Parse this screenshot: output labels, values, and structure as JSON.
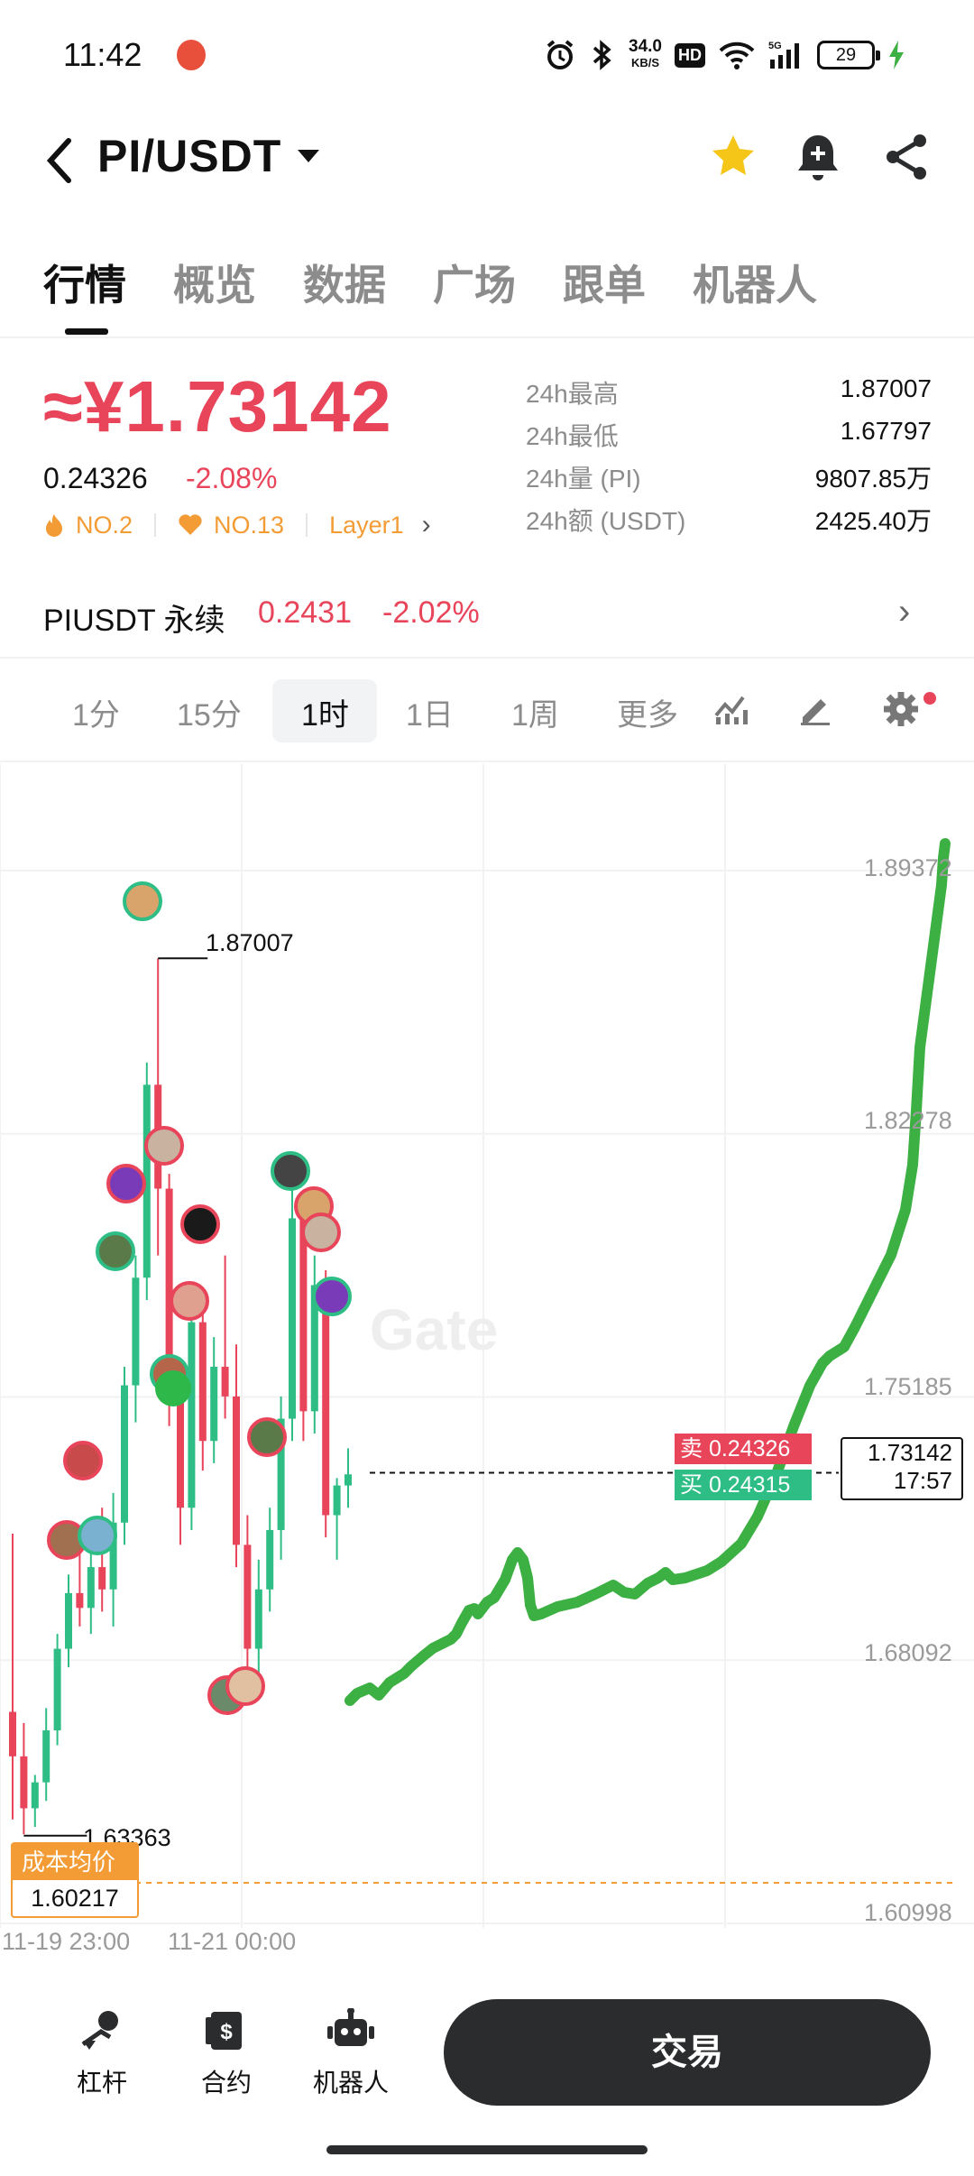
{
  "status_bar": {
    "time": "11:42",
    "net_speed_value": "34.0",
    "net_speed_unit": "KB/S",
    "hd": "HD",
    "network": "5G",
    "battery": "29"
  },
  "header": {
    "title": "PI/USDT",
    "icons": [
      "back-icon",
      "caret-down-icon",
      "star-icon",
      "bell-plus-icon",
      "share-icon"
    ],
    "star_color": "#f5c518"
  },
  "tabs": [
    {
      "label": "行情",
      "active": true
    },
    {
      "label": "概览"
    },
    {
      "label": "数据"
    },
    {
      "label": "广场"
    },
    {
      "label": "跟单"
    },
    {
      "label": "机器人"
    }
  ],
  "price": {
    "main": "≈¥1.73142",
    "usdt": "0.24326",
    "change": "-2.08%",
    "rank1": "NO.2",
    "rank2": "NO.13",
    "sector": "Layer1",
    "down_color": "#e8445a",
    "up_color": "#2ebd85"
  },
  "stats": [
    {
      "label": "24h最高",
      "value": "1.87007"
    },
    {
      "label": "24h最低",
      "value": "1.67797"
    },
    {
      "label": "24h量 (PI)",
      "value": "9807.85万"
    },
    {
      "label": "24h额 (USDT)",
      "value": "2425.40万"
    }
  ],
  "perpetual": {
    "name": "PIUSDT 永续",
    "price": "0.2431",
    "change": "-2.02%"
  },
  "intervals": [
    {
      "label": "1分"
    },
    {
      "label": "15分"
    },
    {
      "label": "1时",
      "active": true
    },
    {
      "label": "1日"
    },
    {
      "label": "1周"
    },
    {
      "label": "更多"
    }
  ],
  "chart": {
    "y_axis": [
      "1.89372",
      "1.82278",
      "1.75185",
      "1.68092",
      "1.60998"
    ],
    "high_label": "1.87007",
    "low_label": "1.63363",
    "sell_label": "卖 0.24326",
    "buy_label": "买 0.24315",
    "current_price": "1.73142",
    "countdown": "17:57",
    "cost_title": "成本均价",
    "cost_value": "1.60217",
    "watermark": "Gate",
    "dates": [
      "11-19 23:00",
      "11-21 00:00"
    ]
  },
  "chart_data": {
    "type": "candlestick",
    "interval": "1时",
    "y_ticks": [
      1.89372,
      1.82278,
      1.75185,
      1.68092,
      1.60998
    ],
    "ylim": [
      1.60998,
      1.89372
    ],
    "x_tick_labels": [
      "11-19 23:00",
      "11-21 00:00"
    ],
    "marked_high": 1.87007,
    "marked_low": 1.63363,
    "current_price": 1.73142,
    "cost_average": 1.60217,
    "candles": [
      {
        "o": 1.667,
        "h": 1.715,
        "l": 1.638,
        "c": 1.655
      },
      {
        "o": 1.655,
        "h": 1.664,
        "l": 1.634,
        "c": 1.641
      },
      {
        "o": 1.641,
        "h": 1.65,
        "l": 1.636,
        "c": 1.648
      },
      {
        "o": 1.648,
        "h": 1.668,
        "l": 1.643,
        "c": 1.662
      },
      {
        "o": 1.662,
        "h": 1.688,
        "l": 1.658,
        "c": 1.684
      },
      {
        "o": 1.684,
        "h": 1.704,
        "l": 1.679,
        "c": 1.699
      },
      {
        "o": 1.699,
        "h": 1.712,
        "l": 1.69,
        "c": 1.695
      },
      {
        "o": 1.695,
        "h": 1.715,
        "l": 1.688,
        "c": 1.706
      },
      {
        "o": 1.706,
        "h": 1.722,
        "l": 1.694,
        "c": 1.7
      },
      {
        "o": 1.7,
        "h": 1.726,
        "l": 1.69,
        "c": 1.718
      },
      {
        "o": 1.718,
        "h": 1.76,
        "l": 1.712,
        "c": 1.755
      },
      {
        "o": 1.755,
        "h": 1.79,
        "l": 1.745,
        "c": 1.784
      },
      {
        "o": 1.784,
        "h": 1.842,
        "l": 1.778,
        "c": 1.836
      },
      {
        "o": 1.836,
        "h": 1.87,
        "l": 1.79,
        "c": 1.808
      },
      {
        "o": 1.808,
        "h": 1.812,
        "l": 1.744,
        "c": 1.752
      },
      {
        "o": 1.752,
        "h": 1.76,
        "l": 1.712,
        "c": 1.722
      },
      {
        "o": 1.722,
        "h": 1.78,
        "l": 1.716,
        "c": 1.772
      },
      {
        "o": 1.772,
        "h": 1.778,
        "l": 1.732,
        "c": 1.74
      },
      {
        "o": 1.74,
        "h": 1.768,
        "l": 1.734,
        "c": 1.76
      },
      {
        "o": 1.76,
        "h": 1.79,
        "l": 1.746,
        "c": 1.752
      },
      {
        "o": 1.752,
        "h": 1.766,
        "l": 1.706,
        "c": 1.712
      },
      {
        "o": 1.712,
        "h": 1.72,
        "l": 1.672,
        "c": 1.684
      },
      {
        "o": 1.684,
        "h": 1.708,
        "l": 1.676,
        "c": 1.7
      },
      {
        "o": 1.7,
        "h": 1.722,
        "l": 1.694,
        "c": 1.716
      },
      {
        "o": 1.716,
        "h": 1.752,
        "l": 1.708,
        "c": 1.746
      },
      {
        "o": 1.746,
        "h": 1.812,
        "l": 1.74,
        "c": 1.8
      },
      {
        "o": 1.8,
        "h": 1.806,
        "l": 1.74,
        "c": 1.748
      },
      {
        "o": 1.748,
        "h": 1.79,
        "l": 1.742,
        "c": 1.782
      },
      {
        "o": 1.782,
        "h": 1.786,
        "l": 1.714,
        "c": 1.72
      },
      {
        "o": 1.72,
        "h": 1.73,
        "l": 1.708,
        "c": 1.728
      },
      {
        "o": 1.728,
        "h": 1.738,
        "l": 1.722,
        "c": 1.731
      }
    ]
  },
  "bottom_bar": {
    "items": [
      {
        "label": "杠杆",
        "icon": "leverage-icon"
      },
      {
        "label": "合约",
        "icon": "contract-icon"
      },
      {
        "label": "机器人",
        "icon": "robot-icon"
      }
    ],
    "trade_label": "交易"
  },
  "annotation_color": "#3cb043"
}
